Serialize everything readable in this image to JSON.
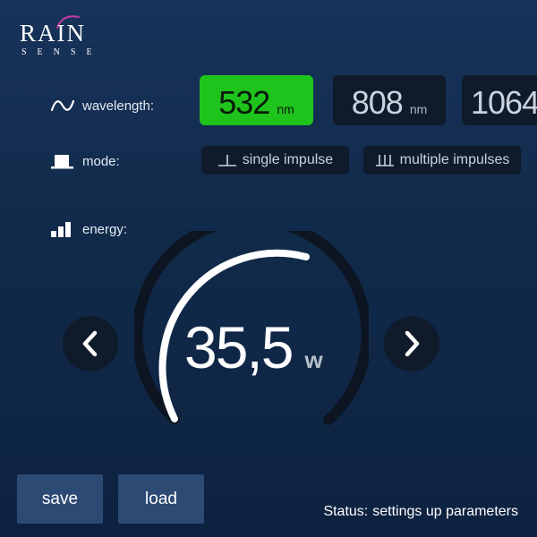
{
  "logo": {
    "main": "RAIN",
    "sub": "SENSE",
    "accent_color": "#c43aa7"
  },
  "wavelength": {
    "label": "wavelength:",
    "icon": "wave-icon",
    "options": [
      {
        "value": "532",
        "unit": "nm",
        "selected": true
      },
      {
        "value": "808",
        "unit": "nm",
        "selected": false
      },
      {
        "value": "1064",
        "unit": "",
        "selected": false
      }
    ]
  },
  "mode": {
    "label": "mode:",
    "icon": "pulse-icon",
    "options": [
      {
        "label": "single impulse",
        "icon": "single-impulse-icon"
      },
      {
        "label": "multiple impulses",
        "icon": "multiple-impulses-icon"
      }
    ]
  },
  "energy": {
    "label": "energy:",
    "icon": "bars-icon",
    "value": "35,5",
    "unit": "w",
    "decrease_icon": "chevron-left-icon",
    "increase_icon": "chevron-right-icon"
  },
  "actions": {
    "save": "save",
    "load": "load"
  },
  "status": {
    "label": "Status:",
    "value": "settings up parameters"
  },
  "colors": {
    "background": "#14304f",
    "selected": "#1ec31c",
    "button_dark": "#0f1b2b",
    "action_button": "#2d4a74"
  }
}
